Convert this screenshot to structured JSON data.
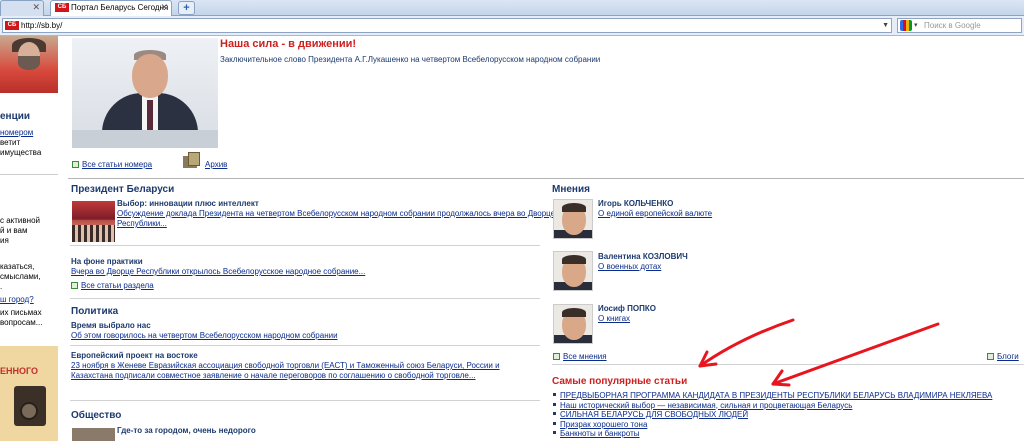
{
  "browser": {
    "tabs": [
      {
        "label": ""
      },
      {
        "label": "Портал Беларусь Сегодня",
        "favicon": "СБ"
      }
    ],
    "new_tab": "+",
    "url": "http://sb.by/",
    "search_placeholder": "Поиск в Google"
  },
  "left_column": {
    "heading": "енции",
    "lines_a": [
      "номером",
      "ветит",
      "имущества"
    ],
    "lines_b": [
      "с активной",
      "й и вам",
      "ия"
    ],
    "lines_c": [
      "казаться,",
      "смыслами,",
      "."
    ],
    "link_c": "ш город?",
    "lines_d": [
      "их письмах",
      "вопросам..."
    ],
    "camera_word": "ЕННОГО"
  },
  "feature": {
    "title": "Наша сила - в движении!",
    "subtitle": "Заключительное слово Президента А.Г.Лукашенко на четвертом Всебелорусском народном собрании",
    "all_link": "Все статьи номера",
    "archive_link": "Архив"
  },
  "president": {
    "title": "Президент Беларуси",
    "item1_title": "Выбор: инновации плюс интеллект",
    "item1_text": "Обсуждение доклада Президента на четвертом Всебелорусском народном собрании продолжалось вчера во Дворце Республики...",
    "item2_title": "На фоне практики",
    "item2_text": "Вчера во Дворце Республики открылось Всебелорусское народное собрание...",
    "all_link": "Все статьи раздела"
  },
  "politics": {
    "title": "Политика",
    "item1_title": "Время выбрало нас",
    "item1_text": "Об этом говорилось на четвертом Всебелорусском народном собрании",
    "item2_title": "Европейский проект на востоке",
    "item2_text": "23 ноября в Женеве Евразийская ассоциация свободной торговли (ЕАСТ) и Таможенный союз Беларуси, России и Казахстана подписали совместное заявление о начале переговоров по соглашению о свободной торговле..."
  },
  "society": {
    "title": "Общество",
    "item1_title": "Где-то за городом, очень недорого"
  },
  "opinions": {
    "title": "Мнения",
    "items": [
      {
        "name": "Игорь КОЛЬЧЕНКО",
        "text": "О единой европейской валюте"
      },
      {
        "name": "Валентина КОЗЛОВИЧ",
        "text": "О военных дотах"
      },
      {
        "name": "Иосиф ПОПКО",
        "text": "О книгах"
      }
    ],
    "all_link": "Все мнения",
    "blogs_link": "Блоги"
  },
  "popular": {
    "title": "Самые популярные статьи",
    "items": [
      "ПРЕДВЫБОРНАЯ ПРОГРАММА КАНДИДАТА В ПРЕЗИДЕНТЫ РЕСПУБЛИКИ БЕЛАРУСЬ ВЛАДИМИРА НЕКЛЯЕВА",
      "Наш исторический выбор — независимая, сильная и процветающая Беларусь",
      "СИЛЬНАЯ БЕЛАРУСЬ ДЛЯ СВОБОДНЫХ ЛЮДЕЙ",
      "Призрак хорошего тона",
      "Банкноты и банкроты"
    ]
  },
  "colors": {
    "headline_red": "#cc2020",
    "section_blue": "#1c3a6e",
    "link_blue": "#0a2c8c",
    "annotation_arrow": "#e8141e"
  }
}
